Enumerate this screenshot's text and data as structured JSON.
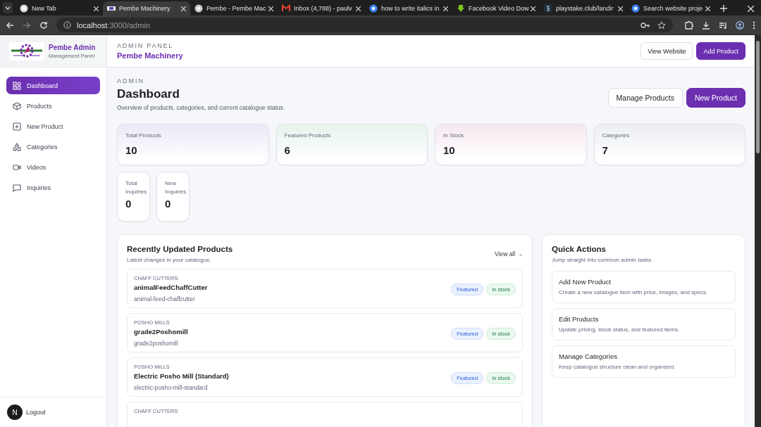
{
  "browser": {
    "tabs": [
      {
        "title": "New Tab",
        "kind": "chrome",
        "selected": false
      },
      {
        "title": "Pembe Machinery",
        "kind": "site",
        "selected": true
      },
      {
        "title": "Pembe - Pembe Mac",
        "kind": "fingerprint",
        "selected": false
      },
      {
        "title": "Inbox (4,788) - paulv",
        "kind": "mail",
        "selected": false
      },
      {
        "title": "how to write italics in",
        "kind": "google",
        "selected": false
      },
      {
        "title": "Facebook Video Dow",
        "kind": "download",
        "selected": false
      },
      {
        "title": "playstake.club/landir",
        "kind": "letter",
        "selected": false
      },
      {
        "title": "Search website proje",
        "kind": "circle",
        "selected": false
      }
    ],
    "address_host": "localhost",
    "address_path": ":3000/admin"
  },
  "sidebar": {
    "brand": "Pembe Admin",
    "subtitle": "Management Panel",
    "items": [
      {
        "label": "Dashboard",
        "kind": "grid",
        "selected": true
      },
      {
        "label": "Products",
        "kind": "box",
        "selected": false
      },
      {
        "label": "New Product",
        "kind": "plus",
        "selected": false
      },
      {
        "label": "Categories",
        "kind": "shapes",
        "selected": false
      },
      {
        "label": "Videos",
        "kind": "video",
        "selected": false
      },
      {
        "label": "Inquiries",
        "kind": "chat",
        "selected": false
      }
    ],
    "avatar": "N",
    "logout": "Logout"
  },
  "header": {
    "eyebrow": "ADMIN PANEL",
    "title": "Pembe Machinery",
    "buttons": [
      {
        "label": "View Website",
        "kind": "outline"
      },
      {
        "label": "Add Product",
        "kind": "primary"
      }
    ]
  },
  "page": {
    "eyebrow": "ADMIN",
    "title": "Dashboard",
    "description": "Overview of products, categories, and current catalogue status.",
    "buttons": [
      {
        "label": "Manage Products",
        "kind": "outline"
      },
      {
        "label": "New Product",
        "kind": "primary"
      }
    ]
  },
  "stats": [
    {
      "label": "Total Products",
      "value": "10",
      "color": "#ece8f6"
    },
    {
      "label": "Featured Products",
      "value": "6",
      "color": "#e6f3ec"
    },
    {
      "label": "In Stock",
      "value": "10",
      "color": "#f6e8f0"
    },
    {
      "label": "Categories",
      "value": "7",
      "color": "#eceef3"
    }
  ],
  "inquiry_stats": [
    {
      "label": "Total Inquiries",
      "value": "0"
    },
    {
      "label": "New Inquiries",
      "value": "0"
    }
  ],
  "recent": {
    "title": "Recently Updated Products",
    "subtitle": "Latest changes in your catalogue.",
    "link": "View all →",
    "products": [
      {
        "category": "CHAFF CUTTERS",
        "name": "animalFeedChaffCutter",
        "slug": "animal-feed-chaffcutter",
        "badges": [
          {
            "label": "Featured",
            "kind": "featured"
          },
          {
            "label": "In stock",
            "kind": "stock"
          }
        ]
      },
      {
        "category": "POSHO MILLS",
        "name": "grade2Poshomill",
        "slug": "grade2poshomill",
        "badges": [
          {
            "label": "Featured",
            "kind": "featured"
          },
          {
            "label": "In stock",
            "kind": "stock"
          }
        ]
      },
      {
        "category": "POSHO MILLS",
        "name": "Electric Posho Mill (Standard)",
        "slug": "electric-posho-mill-standard",
        "badges": [
          {
            "label": "Featured",
            "kind": "featured"
          },
          {
            "label": "In stock",
            "kind": "stock"
          }
        ]
      },
      {
        "category": "CHAFF CUTTERS"
      }
    ]
  },
  "quick_actions": {
    "title": "Quick Actions",
    "subtitle": "Jump straight into common admin tasks.",
    "items": [
      {
        "title": "Add New Product",
        "description": "Create a new catalogue item with price, images, and specs."
      },
      {
        "title": "Edit Products",
        "description": "Update pricing, stock status, and featured items."
      },
      {
        "title": "Manage Categories",
        "description": "Keep catalogue structure clean and organized."
      }
    ]
  }
}
